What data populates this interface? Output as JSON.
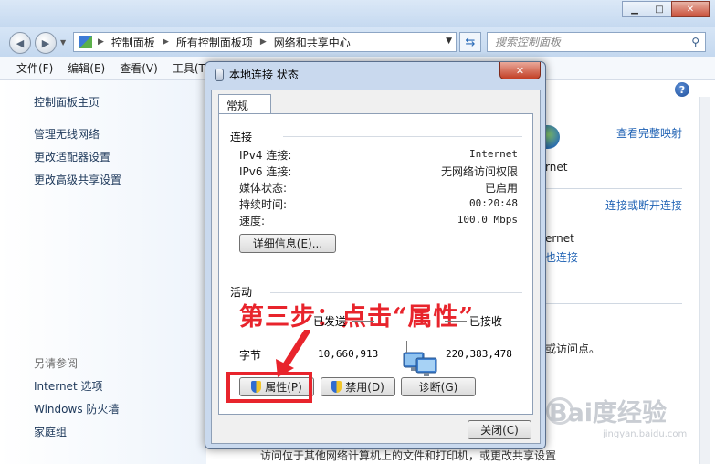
{
  "explorer": {
    "address": [
      "控制面板",
      "所有控制面板项",
      "网络和共享中心"
    ],
    "search_placeholder": "搜索控制面板",
    "menu": [
      "文件(F)",
      "编辑(E)",
      "查看(V)",
      "工具(T)"
    ],
    "left_nav": {
      "home": "控制面板主页",
      "links": [
        "管理无线网络",
        "更改适配器设置",
        "更改高级共享设置"
      ],
      "see_also_title": "另请参阅",
      "see_also": [
        "Internet 选项",
        "Windows 防火墙",
        "家庭组"
      ]
    },
    "right": {
      "view_full_map": "查看完整映射",
      "internet_1": "rnet",
      "connect_disconnect": "连接或断开连接",
      "internet_2": "ernet",
      "connection_link": "也连接",
      "access_point": "或访问点。",
      "bottom_text": "访问位于其他网络计算机上的文件和打印机，或更改共享设置"
    },
    "watermark": "Bai度经验",
    "watermark_sub": "jingyan.baidu.com"
  },
  "dialog": {
    "title": "本地连接 状态",
    "tab": "常规",
    "connection_group": "连接",
    "rows": [
      {
        "label": "IPv4 连接:",
        "value": "Internet"
      },
      {
        "label": "IPv6 连接:",
        "value": "无网络访问权限"
      },
      {
        "label": "媒体状态:",
        "value": "已启用"
      },
      {
        "label": "持续时间:",
        "value": "00:20:48"
      },
      {
        "label": "速度:",
        "value": "100.0 Mbps"
      }
    ],
    "details_button": "详细信息(E)...",
    "activity_group": "活动",
    "sent_label": "已发送",
    "received_label": "已接收",
    "bytes_label": "字节",
    "bytes_sent": "10,660,913",
    "bytes_received": "220,383,478",
    "properties_button": "属性(P)",
    "disable_button": "禁用(D)",
    "diagnose_button": "诊断(G)",
    "close_button": "关闭(C)",
    "annotation": "第三步：点击“属性”"
  },
  "colors": {
    "annotation": "#e8242c",
    "link": "#1f62b4",
    "accent": "#c9d9ee"
  }
}
